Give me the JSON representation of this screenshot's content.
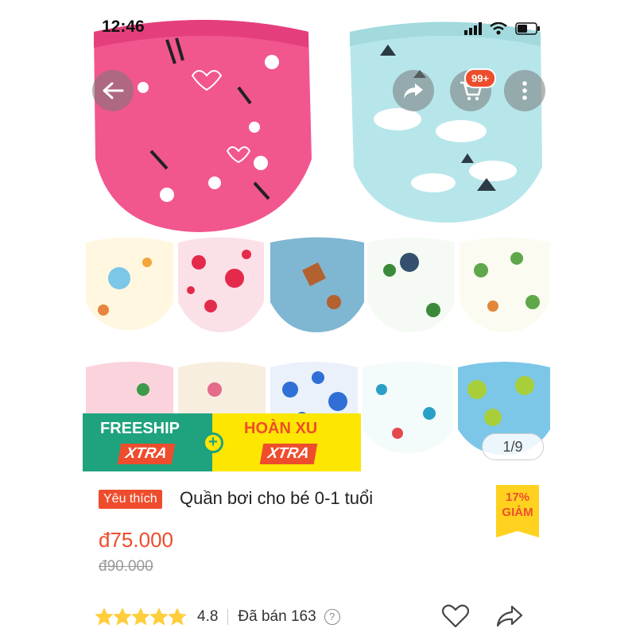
{
  "status_bar": {
    "time": "12:46"
  },
  "header": {
    "cart_badge": "99+"
  },
  "promo_banner": {
    "freeship_label": "FREESHIP",
    "freeship_xtra": "XTRA",
    "plus": "+",
    "coin_label": "HOÀN XU",
    "coin_xtra": "XTRA"
  },
  "gallery": {
    "counter": "1/9"
  },
  "product": {
    "tag": "Yêu thích",
    "title": "Quần bơi cho bé 0-1 tuổi",
    "discount_pct": "17%",
    "discount_label": "GIẢM",
    "price": "đ75.000",
    "old_price": "đ90.000",
    "rating": "4.8",
    "rating_value": 4.8,
    "sold": "Đã bán 163",
    "help": "?"
  },
  "colors": {
    "accent": "#ee4d2d",
    "green": "#1fa27e",
    "yellow": "#fde600",
    "star": "#ffce3d"
  },
  "icons": [
    "back-arrow-icon",
    "share-icon",
    "cart-icon",
    "more-icon",
    "heart-icon",
    "share-outline-icon",
    "star-icon",
    "signal-icon",
    "wifi-icon",
    "battery-icon"
  ]
}
